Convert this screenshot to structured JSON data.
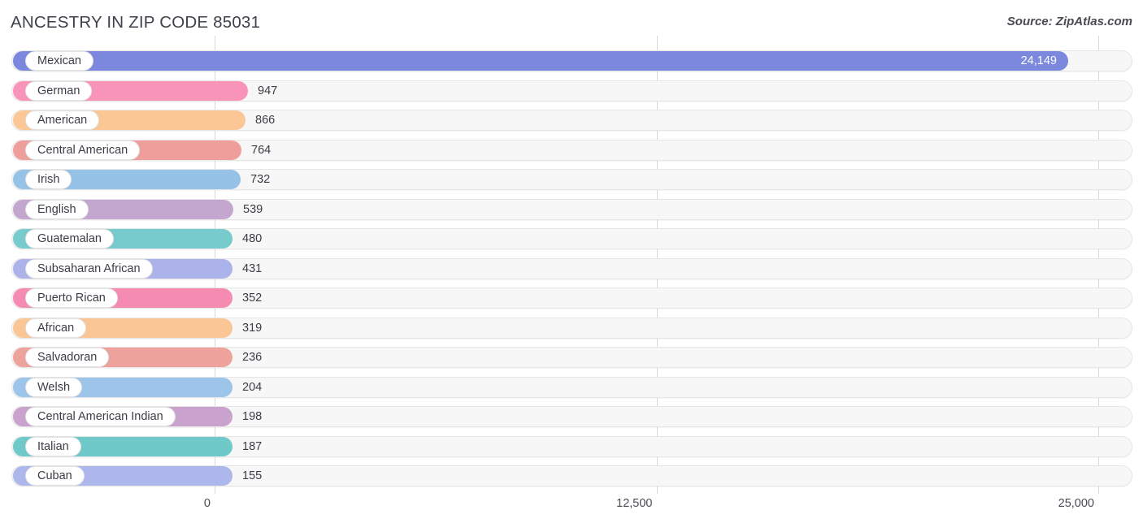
{
  "header": {
    "title": "ANCESTRY IN ZIP CODE 85031",
    "source": "Source: ZipAtlas.com"
  },
  "chart_data": {
    "type": "bar",
    "orientation": "horizontal",
    "title": "ANCESTRY IN ZIP CODE 85031",
    "xlabel": "",
    "ylabel": "",
    "xlim": [
      0,
      25000
    ],
    "grid": true,
    "gridlines": [
      0,
      12500,
      25000
    ],
    "tick_labels": [
      "0",
      "12,500",
      "25,000"
    ],
    "legend": "none",
    "categories": [
      "Mexican",
      "German",
      "American",
      "Central American",
      "Irish",
      "English",
      "Guatemalan",
      "Subsaharan African",
      "Puerto Rican",
      "African",
      "Salvadoran",
      "Welsh",
      "Central American Indian",
      "Italian",
      "Cuban"
    ],
    "values": [
      24149,
      947,
      866,
      764,
      732,
      539,
      480,
      431,
      352,
      319,
      236,
      204,
      198,
      187,
      155
    ],
    "value_labels": [
      "24,149",
      "947",
      "866",
      "764",
      "732",
      "539",
      "480",
      "431",
      "352",
      "319",
      "236",
      "204",
      "198",
      "187",
      "155"
    ],
    "bar_colors": [
      "#7b88de",
      "#f794b8",
      "#fac795",
      "#ef9f9b",
      "#97c2e8",
      "#c3a7ce",
      "#78cbcc",
      "#abb3ea",
      "#f58bb0",
      "#fac695",
      "#eda29c",
      "#9dc5ea",
      "#c9a3cd",
      "#6fc9c9",
      "#aeb7ec"
    ],
    "value_label_inside": [
      true,
      false,
      false,
      false,
      false,
      false,
      false,
      false,
      false,
      false,
      false,
      false,
      false,
      false,
      false
    ]
  },
  "colors": {
    "track_bg": "#f7f7f7",
    "track_border": "#e6e6e6",
    "gridline": "#d9d9dd",
    "text": "#3c3c46",
    "value_inside_text": "#ffffff"
  }
}
